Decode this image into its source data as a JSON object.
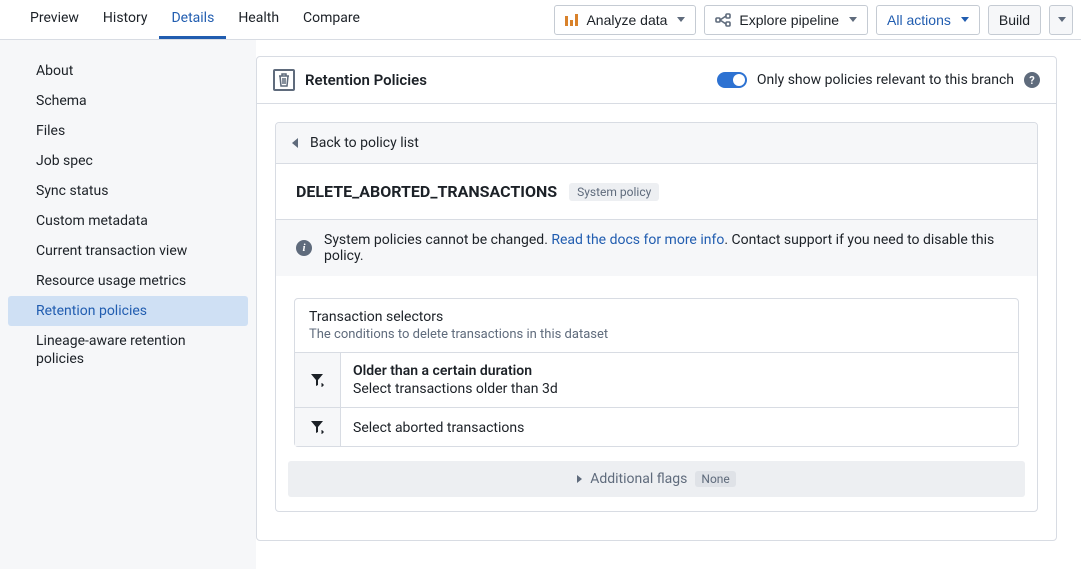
{
  "topbar": {
    "tabs": [
      "Preview",
      "History",
      "Details",
      "Health",
      "Compare"
    ],
    "active_tab_index": 2,
    "analyze_label": "Analyze data",
    "explore_label": "Explore pipeline",
    "all_actions_label": "All actions",
    "build_label": "Build"
  },
  "sidebar": {
    "items": [
      "About",
      "Schema",
      "Files",
      "Job spec",
      "Sync status",
      "Custom metadata",
      "Current transaction view",
      "Resource usage metrics",
      "Retention policies",
      "Lineage-aware retention policies"
    ],
    "active_index": 8
  },
  "panel": {
    "title": "Retention Policies",
    "toggle_label": "Only show policies relevant to this branch",
    "toggle_on": true
  },
  "policy": {
    "back_label": "Back to policy list",
    "name": "DELETE_ABORTED_TRANSACTIONS",
    "system_chip": "System policy",
    "notice_pre": "System policies cannot be changed. ",
    "notice_link": "Read the docs for more info",
    "notice_post": ". Contact support if you need to disable this policy.",
    "selectors": {
      "title": "Transaction selectors",
      "subtitle": "The conditions to delete transactions in this dataset",
      "rows": [
        {
          "title": "Older than a certain duration",
          "desc": "Select transactions older than 3d"
        },
        {
          "title": "",
          "desc": "Select aborted transactions"
        }
      ]
    },
    "flags": {
      "label": "Additional flags",
      "value": "None"
    }
  }
}
